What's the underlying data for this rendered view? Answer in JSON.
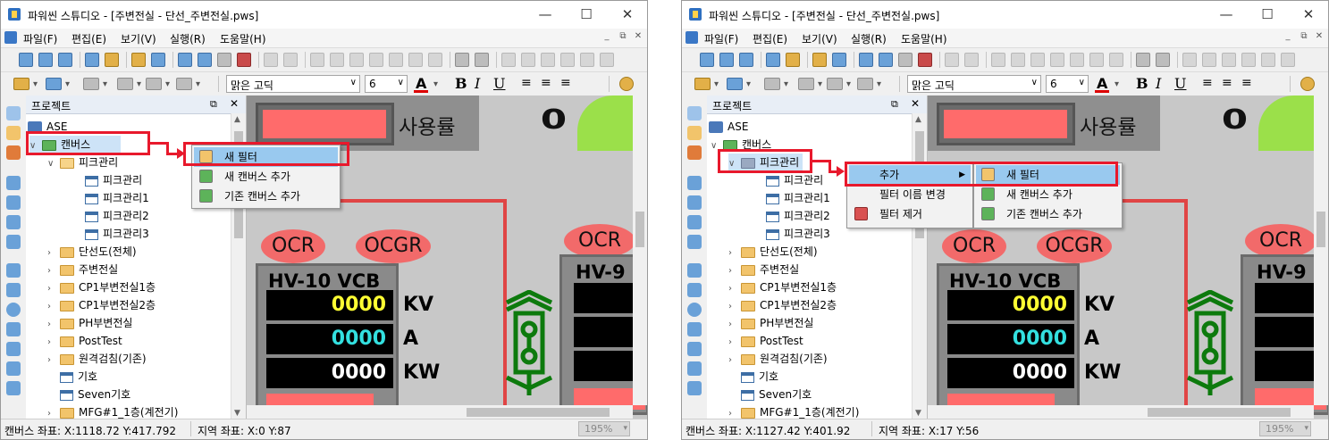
{
  "window1": {
    "title": "파워씬 스튜디오 - [주변전실 - 단선_주변전실.pws]",
    "menu": [
      "파일(F)",
      "편집(E)",
      "보기(V)",
      "실행(R)",
      "도움말(H)"
    ],
    "font_name": "맑은 고딕",
    "font_size": "6",
    "panel_title": "프로젝트",
    "tree": {
      "root": "ASE",
      "canvas": "캔버스",
      "filter": "피크관리",
      "filter_children": [
        "피크관리",
        "피크관리1",
        "피크관리2",
        "피크관리3"
      ],
      "folders": [
        "단선도(전체)",
        "주변전실",
        "CP1부변전실1층",
        "CP1부변전실2층",
        "PH부변전실",
        "PostTest",
        "원격검침(기존)"
      ],
      "items": [
        "기호",
        "Seven기호",
        "MFG#1_1층(계전기)"
      ]
    },
    "context_menu": [
      "새 필터",
      "새 캔버스 추가",
      "기존 캔버스 추가"
    ],
    "status": {
      "canvas_coord": "캔버스 좌표: X:1118.72 Y:417.792",
      "local_coord": "지역 좌표: X:0 Y:87",
      "zoom": "195%"
    },
    "canvas": {
      "usage": "사용률",
      "ocr": "OCR",
      "ocgr": "OCGR",
      "vcb": "HV-10 VCB",
      "vcb2": "HV-9",
      "v1": "0000",
      "u1": "KV",
      "v2": "0000",
      "u2": "A",
      "v3": "0000",
      "u3": "KW",
      "zero": "0"
    }
  },
  "window2": {
    "title": "파워씬 스튜디오 - [주변전실 - 단선_주변전실.pws]",
    "menu": [
      "파일(F)",
      "편집(E)",
      "보기(V)",
      "실행(R)",
      "도움말(H)"
    ],
    "font_name": "맑은 고딕",
    "font_size": "6",
    "panel_title": "프로젝트",
    "tree": {
      "root": "ASE",
      "canvas": "캔버스",
      "filter": "피크관리",
      "filter_children": [
        "피크관리",
        "피크관리1",
        "피크관리2",
        "피크관리3"
      ],
      "folders": [
        "단선도(전체)",
        "주변전실",
        "CP1부변전실1층",
        "CP1부변전실2층",
        "PH부변전실",
        "PostTest",
        "원격검침(기존)"
      ],
      "items": [
        "기호",
        "Seven기호",
        "MFG#1_1층(계전기)"
      ]
    },
    "context_menu": [
      "추가",
      "필터 이름 변경",
      "필터 제거"
    ],
    "submenu": [
      "새 필터",
      "새 캔버스 추가",
      "기존 캔버스 추가"
    ],
    "status": {
      "canvas_coord": "캔버스 좌표: X:1127.42 Y:401.92",
      "local_coord": "지역 좌표: X:17 Y:56",
      "zoom": "195%"
    },
    "canvas": {
      "usage": "사용률",
      "ocr": "OCR",
      "ocgr": "OCGR",
      "vcb": "HV-10 VCB",
      "vcb2": "HV-9",
      "v1": "0000",
      "u1": "KV",
      "v2": "0000",
      "u2": "A",
      "v3": "0000",
      "u3": "KW",
      "zero": "0"
    }
  },
  "colors": {
    "highlight_red": "#e8192c",
    "meter_yellow": "#ffff33",
    "meter_cyan": "#33e0e0",
    "oval": "#f26a6a",
    "selection": "#99c9ef"
  }
}
